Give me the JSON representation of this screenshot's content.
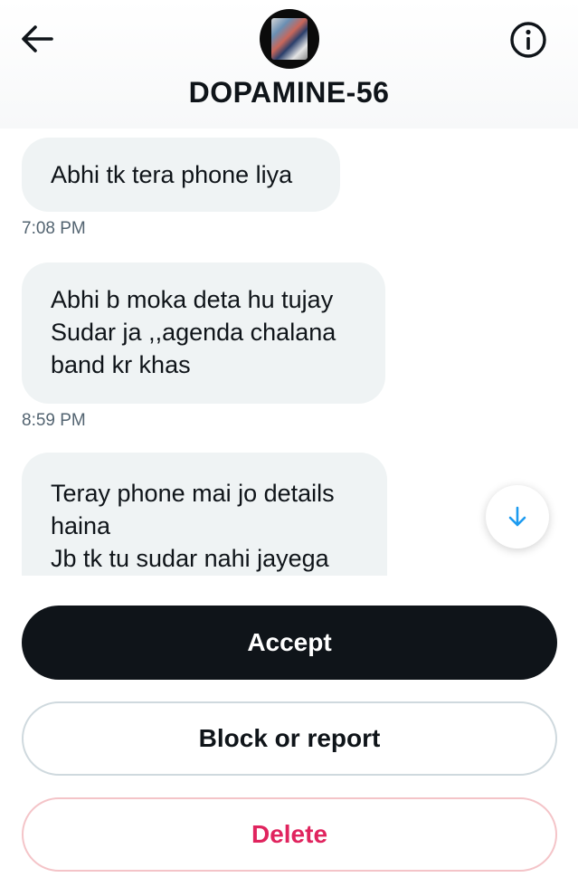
{
  "header": {
    "back_icon": "arrow-left-icon",
    "info_icon": "info-circle-icon",
    "title": "DOPAMINE-56"
  },
  "messages": [
    {
      "lines": [
        "Abhi tk tera phone liya"
      ],
      "time": "7:08 PM"
    },
    {
      "lines": [
        "Abhi b moka deta hu tujay",
        "Sudar ja ,,agenda chalana",
        "band kr khas"
      ],
      "time": "8:59 PM"
    },
    {
      "lines": [
        "Teray phone mai jo details",
        "haina",
        "Jb tk tu sudar nahi jayega"
      ]
    }
  ],
  "scroll_down_icon": "arrow-down-icon",
  "actions": {
    "accept": "Accept",
    "block_report": "Block or report",
    "delete": "Delete"
  },
  "colors": {
    "bubble_bg": "#eff3f4",
    "accept_bg": "#0f1419",
    "delete_text": "#e0245e",
    "scroll_arrow": "#1d9bf0"
  }
}
